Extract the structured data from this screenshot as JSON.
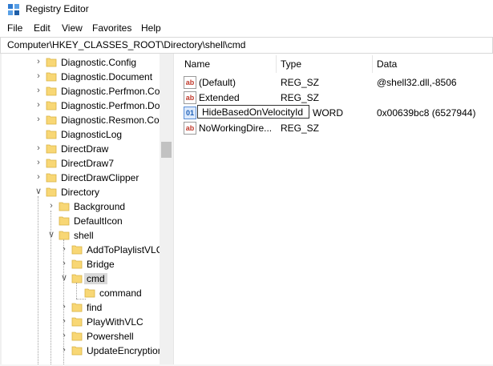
{
  "window": {
    "title": "Registry Editor"
  },
  "menu": [
    "File",
    "Edit",
    "View",
    "Favorites",
    "Help"
  ],
  "address": "Computer\\HKEY_CLASSES_ROOT\\Directory\\shell\\cmd",
  "tree": [
    {
      "label": "Diagnostic.Config",
      "level": 0,
      "chevron": "right"
    },
    {
      "label": "Diagnostic.Document",
      "level": 0,
      "chevron": "right"
    },
    {
      "label": "Diagnostic.Perfmon.Co",
      "level": 0,
      "chevron": "right"
    },
    {
      "label": "Diagnostic.Perfmon.Do",
      "level": 0,
      "chevron": "right"
    },
    {
      "label": "Diagnostic.Resmon.Cor",
      "level": 0,
      "chevron": "right"
    },
    {
      "label": "DiagnosticLog",
      "level": 0,
      "chevron": ""
    },
    {
      "label": "DirectDraw",
      "level": 0,
      "chevron": "right"
    },
    {
      "label": "DirectDraw7",
      "level": 0,
      "chevron": "right"
    },
    {
      "label": "DirectDrawClipper",
      "level": 0,
      "chevron": "right"
    },
    {
      "label": "Directory",
      "level": 0,
      "chevron": "down"
    },
    {
      "label": "Background",
      "level": 1,
      "chevron": "right"
    },
    {
      "label": "DefaultIcon",
      "level": 1,
      "chevron": ""
    },
    {
      "label": "shell",
      "level": 1,
      "chevron": "down"
    },
    {
      "label": "AddToPlaylistVLC",
      "level": 2,
      "chevron": "right"
    },
    {
      "label": "Bridge",
      "level": 2,
      "chevron": "right"
    },
    {
      "label": "cmd",
      "level": 2,
      "chevron": "down",
      "selected": true
    },
    {
      "label": "command",
      "level": 3,
      "chevron": ""
    },
    {
      "label": "find",
      "level": 2,
      "chevron": "right"
    },
    {
      "label": "PlayWithVLC",
      "level": 2,
      "chevron": "right"
    },
    {
      "label": "Powershell",
      "level": 2,
      "chevron": "right"
    },
    {
      "label": "UpdateEncryption",
      "level": 2,
      "chevron": "right"
    }
  ],
  "list": {
    "columns": [
      "Name",
      "Type",
      "Data"
    ],
    "rows": [
      {
        "name": "(Default)",
        "type": "REG_SZ",
        "data": "@shell32.dll,-8506",
        "icon": "string-value-icon"
      },
      {
        "name": "Extended",
        "type": "REG_SZ",
        "data": "",
        "icon": "string-value-icon"
      },
      {
        "name": "",
        "type": "WORD",
        "data": "0x00639bc8 (6527944)",
        "icon": "binary-value-icon",
        "editing": "HideBasedOnVelocityId"
      },
      {
        "name": "NoWorkingDire...",
        "type": "REG_SZ",
        "data": "",
        "icon": "string-value-icon"
      }
    ]
  }
}
